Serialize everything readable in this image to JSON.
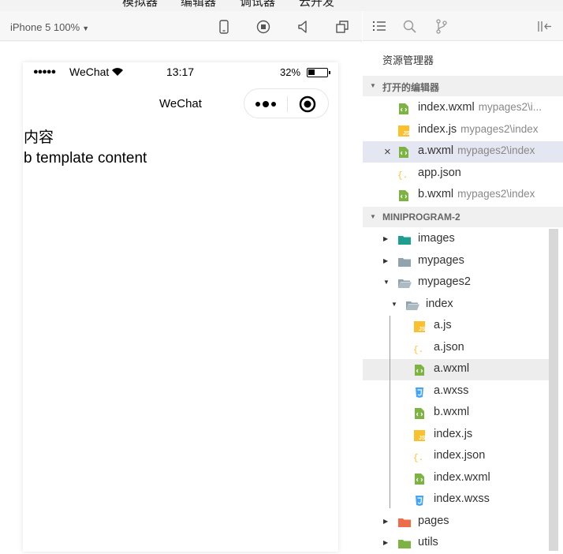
{
  "menubar": {
    "items": [
      "模拟器",
      "编辑器",
      "调试器",
      "云开发"
    ]
  },
  "simulator": {
    "device_label": "iPhone 5 100%",
    "toolbar_icons": [
      "phone-icon",
      "record-icon",
      "volume-icon",
      "window-icon"
    ],
    "status": {
      "dots": "●●●●●",
      "carrier": "WeChat",
      "time": "13:17",
      "battery_pct": "32%"
    },
    "nav_title": "WeChat",
    "content_lines": [
      "内容",
      "b template content"
    ]
  },
  "explorer": {
    "title": "资源管理器",
    "open_editors_label": "打开的编辑器",
    "open_editors": [
      {
        "name": "index.wxml",
        "path": "mypages2\\i...",
        "icon": "wxml"
      },
      {
        "name": "index.js",
        "path": "mypages2\\index",
        "icon": "js"
      },
      {
        "name": "a.wxml",
        "path": "mypages2\\index",
        "icon": "wxml",
        "active": true,
        "close": "×"
      },
      {
        "name": "app.json",
        "path": "",
        "icon": "json"
      },
      {
        "name": "b.wxml",
        "path": "mypages2\\index",
        "icon": "wxml"
      }
    ],
    "project_label": "MINIPROGRAM-2",
    "tree": [
      {
        "name": "images",
        "type": "folder",
        "depth": 0,
        "expanded": false,
        "color": "#1e9e8f"
      },
      {
        "name": "mypages",
        "type": "folder",
        "depth": 0,
        "expanded": false,
        "color": "#90a4ae"
      },
      {
        "name": "mypages2",
        "type": "folder",
        "depth": 0,
        "expanded": true,
        "color": "#90a4ae"
      },
      {
        "name": "index",
        "type": "folder",
        "depth": 1,
        "expanded": true,
        "color": "#90a4ae"
      },
      {
        "name": "a.js",
        "type": "js",
        "depth": 2
      },
      {
        "name": "a.json",
        "type": "json",
        "depth": 2
      },
      {
        "name": "a.wxml",
        "type": "wxml",
        "depth": 2,
        "highlight": true
      },
      {
        "name": "a.wxss",
        "type": "wxss",
        "depth": 2
      },
      {
        "name": "b.wxml",
        "type": "wxml",
        "depth": 2
      },
      {
        "name": "index.js",
        "type": "js",
        "depth": 2
      },
      {
        "name": "index.json",
        "type": "json",
        "depth": 2
      },
      {
        "name": "index.wxml",
        "type": "wxml",
        "depth": 2
      },
      {
        "name": "index.wxss",
        "type": "wxss",
        "depth": 2
      },
      {
        "name": "pages",
        "type": "folder",
        "depth": 0,
        "expanded": false,
        "color": "#ef6c4a"
      },
      {
        "name": "utils",
        "type": "folder",
        "depth": 0,
        "expanded": false,
        "color": "#7cb342"
      }
    ]
  },
  "colors": {
    "wxml": "#7cb342",
    "js": "#fbc02d",
    "json": "#fbc02d",
    "wxss": "#42a5f5",
    "selection": "#e4e6f1"
  }
}
